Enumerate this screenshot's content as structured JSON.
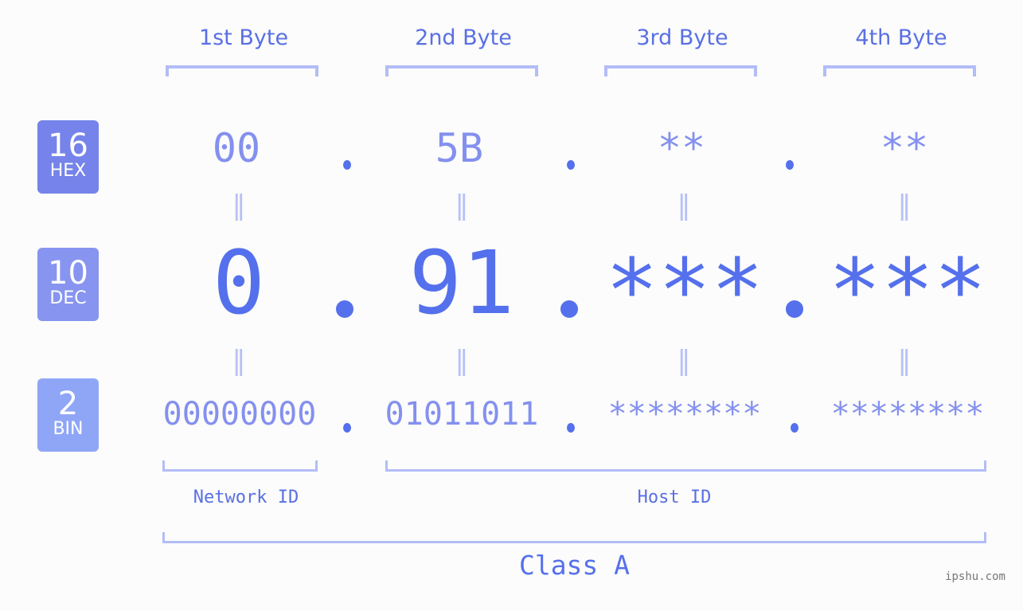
{
  "bytes": [
    {
      "header": "1st Byte",
      "hex": "00",
      "dec": "0",
      "bin": "00000000"
    },
    {
      "header": "2nd Byte",
      "hex": "5B",
      "dec": "91",
      "bin": "01011011"
    },
    {
      "header": "3rd Byte",
      "hex": "**",
      "dec": "***",
      "bin": "********"
    },
    {
      "header": "4th Byte",
      "hex": "**",
      "dec": "***",
      "bin": "********"
    }
  ],
  "badges": {
    "hex": {
      "num": "16",
      "label": "HEX",
      "color": "#7583ea"
    },
    "dec": {
      "num": "10",
      "label": "DEC",
      "color": "#8794f0"
    },
    "bin": {
      "num": "2",
      "label": "BIN",
      "color": "#8fa6f7"
    }
  },
  "equals_sign": "=",
  "separator": ".",
  "network_id_label": "Network ID",
  "host_id_label": "Host ID",
  "class_label": "Class A",
  "watermark": "ipshu.com",
  "colors": {
    "accent": "#5570ec",
    "muted_value": "#8490ef",
    "bracket": "#b3bdf7",
    "background": "#fbfcfb"
  }
}
